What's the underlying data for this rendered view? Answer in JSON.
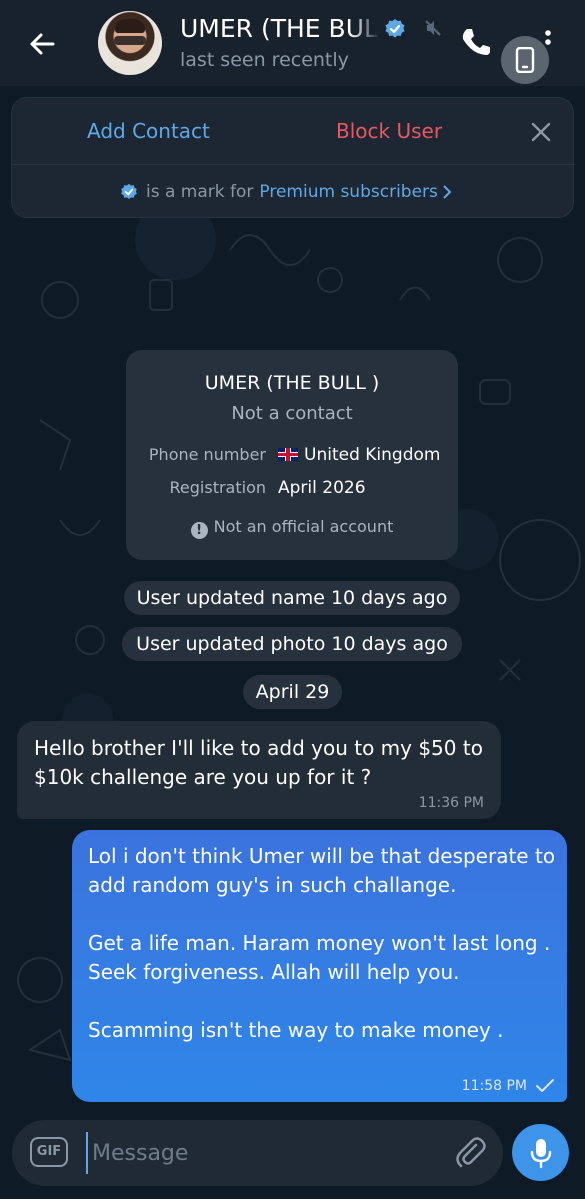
{
  "header": {
    "title": "UMER (THE BULL )",
    "subtitle": "last seen recently"
  },
  "action_panel": {
    "add_contact": "Add Contact",
    "block_user": "Block User",
    "premium_text": "is a mark for",
    "premium_link": "Premium subscribers"
  },
  "info_card": {
    "name": "UMER (THE BULL )",
    "status": "Not a contact",
    "phone_label": "Phone number",
    "phone_value": "United Kingdom",
    "registration_label": "Registration",
    "registration_value": "April 2026",
    "warning": "Not an official account"
  },
  "service_messages": {
    "name_update": "User updated name 10 days ago",
    "photo_update": "User updated photo 10 days ago",
    "date": "April 29"
  },
  "messages": {
    "incoming": {
      "text": "Hello brother I'll like to add you to my $50 to $10k challenge are you up for it ?",
      "time": "11:36 PM"
    },
    "outgoing": {
      "text": "Lol i don't think Umer will be that desperate to add random guy's in such challange.\n\nGet a life man. Haram money won't last long . Seek forgiveness. Allah will help you.\n\nScamming isn't the way to make money .",
      "time": "11:58 PM"
    }
  },
  "composer": {
    "gif_label": "GIF",
    "placeholder": "Message"
  },
  "colors": {
    "accent": "#5ea8e6",
    "danger": "#e8585e",
    "outgoing_bubble": "#3b73de",
    "mic_button": "#3d94e8"
  },
  "icons": [
    "back-arrow-icon",
    "verified-icon",
    "muted-icon",
    "phone-icon",
    "device-icon",
    "more-icon",
    "close-icon",
    "chevron-right-icon",
    "info-icon",
    "check-icon",
    "attach-icon",
    "mic-icon"
  ]
}
